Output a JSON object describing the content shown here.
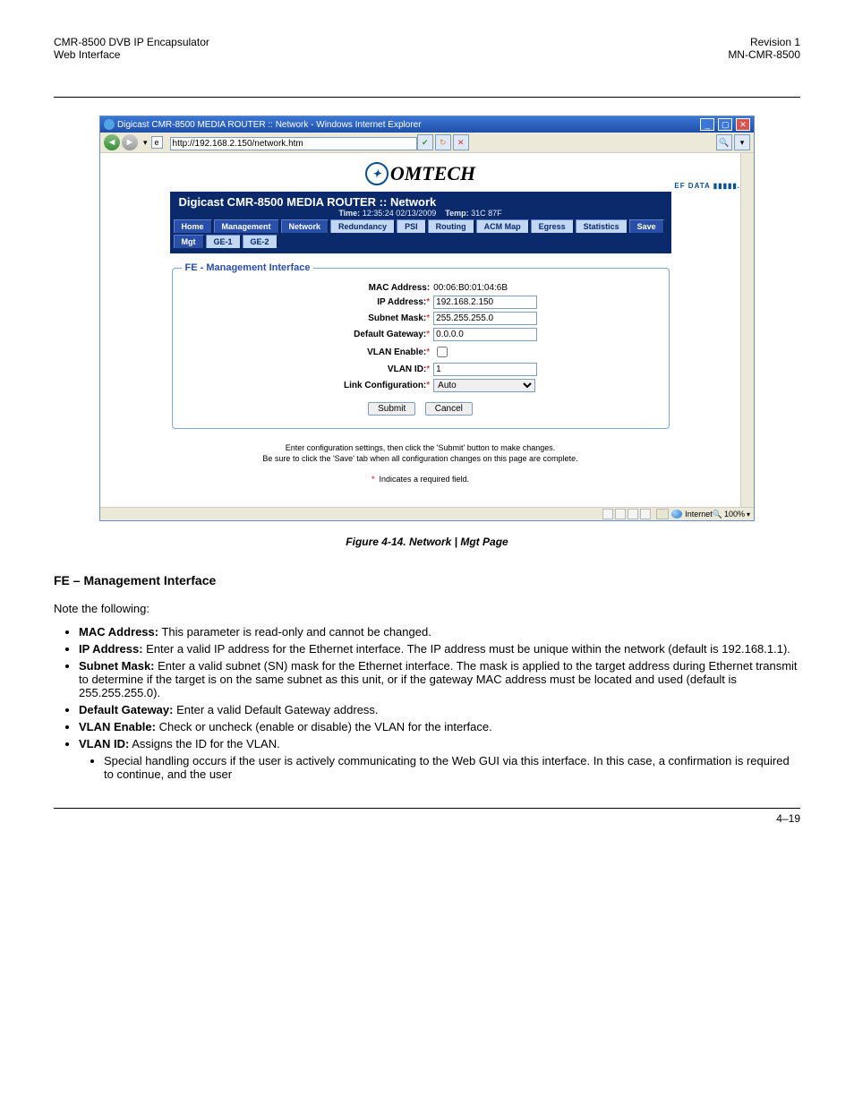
{
  "doc": {
    "header_left": "CMR-8500 DVB IP Encapsulator",
    "header_right": "Revision 1",
    "header_sub_left": "Web Interface",
    "header_sub_right": "MN-CMR-8500",
    "caption": "Figure 4-14. Network | Mgt Page",
    "heading": "FE – Management Interface",
    "intro": "Note the following:",
    "bullets": [
      {
        "label": "MAC Address:",
        "text": " This parameter is read-only and cannot be changed."
      },
      {
        "label": "IP Address:",
        "text": "  Enter a valid IP address for the Ethernet interface.  The IP address must be unique within the network (default is 192.168.1.1)."
      },
      {
        "label": "Subnet Mask:",
        "text": "  Enter a valid subnet (SN) mask for the Ethernet interface.  The mask is applied to the target address during Ethernet transmit to determine if the target is on the same subnet as this unit, or if the gateway MAC address must be located and used (default is 255.255.255.0)."
      },
      {
        "label": "Default Gateway:",
        "text": " Enter a valid Default Gateway address."
      },
      {
        "label": "VLAN Enable:",
        "text": " Check or uncheck (enable or disable) the VLAN for the interface."
      },
      {
        "label": "VLAN ID:",
        "text": " Assigns the ID for the VLAN."
      }
    ],
    "sub_bullet": {
      "text": "Special handling occurs if the user is actively communicating to the Web GUI via this interface. In this case, a confirmation is required to continue, and the user"
    },
    "footer_page": "4–19"
  },
  "win": {
    "title": "Digicast CMR-8500 MEDIA ROUTER :: Network - Windows Internet Explorer",
    "url": "http://192.168.2.150/network.htm",
    "logo_main": "OMTECH",
    "logo_sub": "EF DATA ▮▮▮▮▮.",
    "page_title": "Digicast CMR-8500 MEDIA ROUTER :: Network",
    "time_label": "Time:",
    "time_value": "12:35:24 02/13/2009",
    "temp_label": "Temp:",
    "temp_value": "31C  87F",
    "tabs_row1": [
      "Home",
      "Management",
      "Network",
      "Redundancy",
      "PSI",
      "Routing",
      "ACM Map",
      "Egress",
      "Statistics",
      "Save"
    ],
    "tabs_row2": [
      "Mgt",
      "GE-1",
      "GE-2"
    ],
    "legend": "FE - Management Interface",
    "fields": {
      "mac_label": "MAC Address:",
      "mac_value": "00:06:B0:01:04:6B",
      "ip_label": "IP Address:",
      "ip_value": "192.168.2.150",
      "sn_label": "Subnet Mask:",
      "sn_value": "255.255.255.0",
      "gw_label": "Default Gateway:",
      "gw_value": "0.0.0.0",
      "vlan_en_label": "VLAN Enable:",
      "vlan_id_label": "VLAN ID:",
      "vlan_id_value": "1",
      "link_label": "Link Configuration:",
      "link_value": "Auto"
    },
    "submit": "Submit",
    "cancel": "Cancel",
    "help1": "Enter configuration settings, then click the 'Submit' button to make changes.",
    "help2": "Be sure to click the 'Save' tab when all configuration changes on this page are complete.",
    "help3": "Indicates a required field.",
    "status_zone": "Internet",
    "zoom": "100%"
  },
  "chart_data": {
    "type": "table",
    "title": "FE – Management Interface form fields",
    "fields": [
      {
        "label": "MAC Address",
        "value": "00:06:B0:01:04:6B",
        "required": false,
        "type": "readonly"
      },
      {
        "label": "IP Address",
        "value": "192.168.2.150",
        "required": true,
        "type": "text"
      },
      {
        "label": "Subnet Mask",
        "value": "255.255.255.0",
        "required": true,
        "type": "text"
      },
      {
        "label": "Default Gateway",
        "value": "0.0.0.0",
        "required": true,
        "type": "text"
      },
      {
        "label": "VLAN Enable",
        "value": false,
        "required": true,
        "type": "checkbox"
      },
      {
        "label": "VLAN ID",
        "value": "1",
        "required": true,
        "type": "text"
      },
      {
        "label": "Link Configuration",
        "value": "Auto",
        "required": true,
        "type": "select"
      }
    ]
  }
}
